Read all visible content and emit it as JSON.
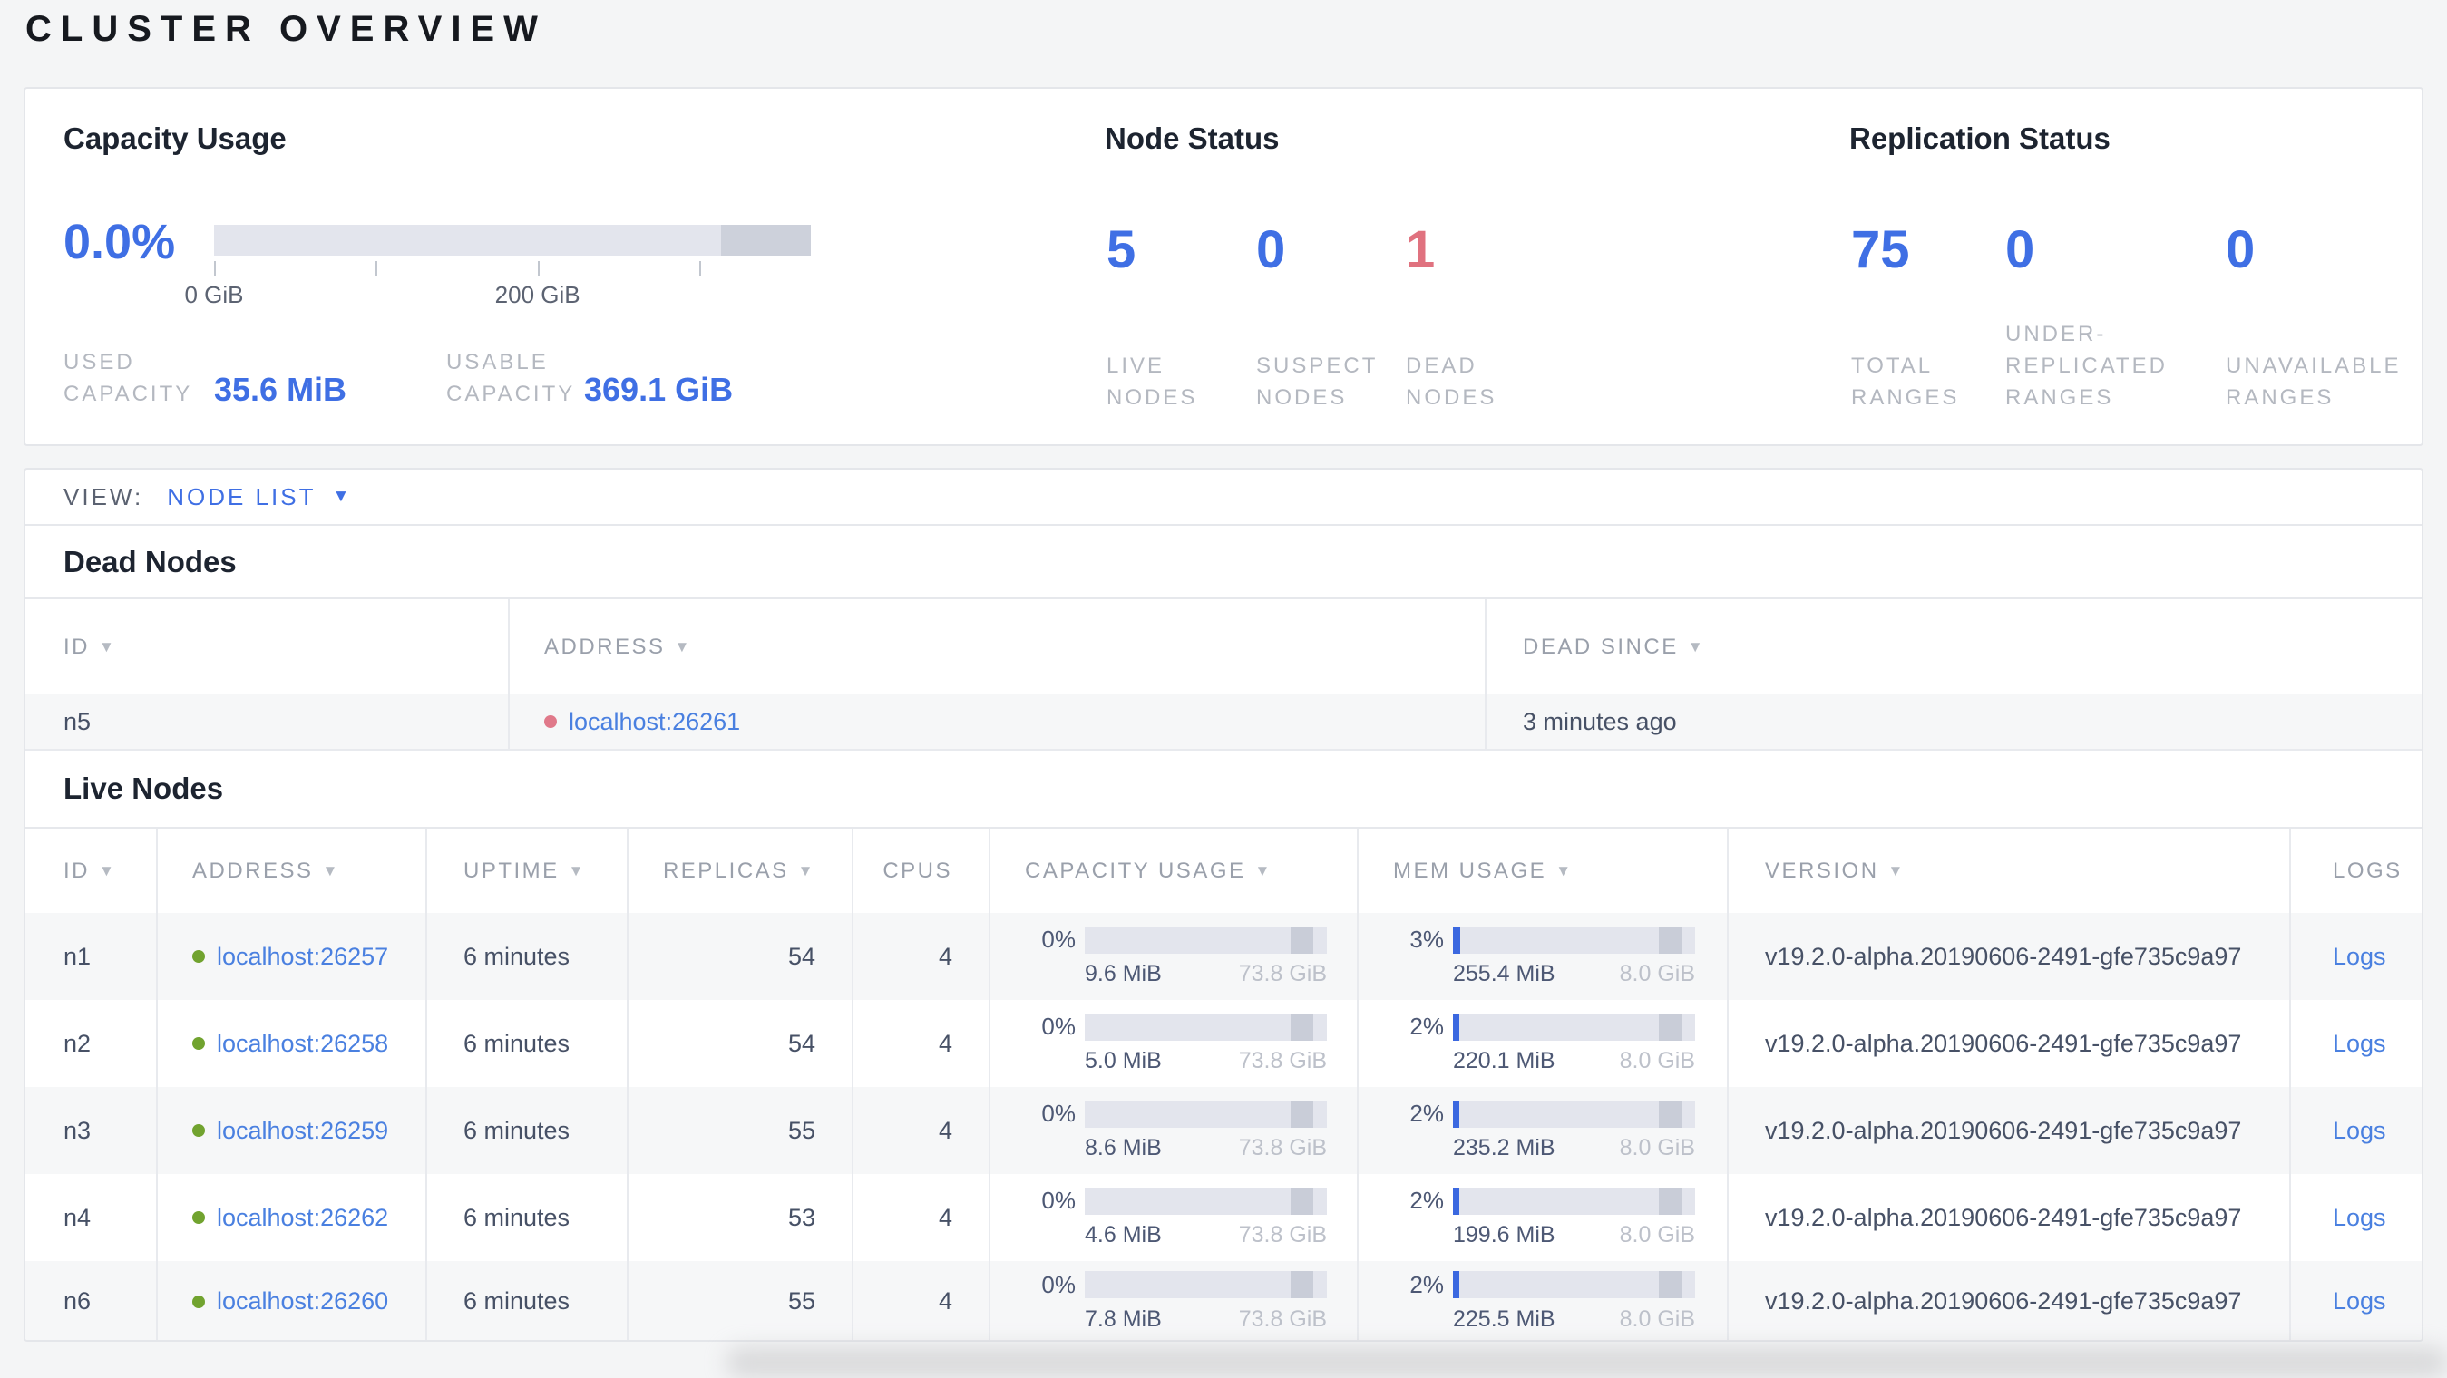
{
  "page": {
    "title": "CLUSTER OVERVIEW"
  },
  "colors": {
    "accent_blue": "#3f6fe4",
    "danger_red": "#e0727f",
    "link_blue": "#4a80e0",
    "live_green": "#71a32f",
    "dead_red": "#e0798a",
    "bar_track": "#e3e5ed",
    "bar_remainder": "#cdd1db",
    "bar_used_blue": "#3b68e0"
  },
  "summary": {
    "capacity": {
      "heading": "Capacity Usage",
      "percent": "0.0%",
      "axis": {
        "tick0_label": "0 GiB",
        "tick2_label": "200 GiB"
      },
      "stats": [
        {
          "label": "USED\nCAPACITY",
          "value": "35.6 MiB"
        },
        {
          "label": "USABLE\nCAPACITY",
          "value": "369.1 GiB"
        }
      ]
    },
    "node_status": {
      "heading": "Node Status",
      "stats": [
        {
          "value": "5",
          "label": "LIVE\nNODES"
        },
        {
          "value": "0",
          "label": "SUSPECT\nNODES"
        },
        {
          "value": "1",
          "label": "DEAD\nNODES"
        }
      ]
    },
    "replication": {
      "heading": "Replication Status",
      "stats": [
        {
          "value": "75",
          "label": "TOTAL\nRANGES"
        },
        {
          "value": "0",
          "label": "UNDER-\nREPLICATED\nRANGES"
        },
        {
          "value": "0",
          "label": "UNAVAILABLE\nRANGES"
        }
      ]
    }
  },
  "view_bar": {
    "label": "VIEW:",
    "selected": "NODE LIST"
  },
  "dead_nodes": {
    "heading": "Dead Nodes",
    "columns": [
      {
        "label": "ID"
      },
      {
        "label": "ADDRESS"
      },
      {
        "label": "DEAD SINCE"
      }
    ],
    "rows": [
      {
        "id": "n5",
        "address": "localhost:26261",
        "dead_since": "3 minutes ago"
      }
    ]
  },
  "live_nodes": {
    "heading": "Live Nodes",
    "logs_label": "Logs",
    "columns": [
      {
        "label": "ID"
      },
      {
        "label": "ADDRESS"
      },
      {
        "label": "UPTIME"
      },
      {
        "label": "REPLICAS"
      },
      {
        "label": "CPUS"
      },
      {
        "label": "CAPACITY USAGE"
      },
      {
        "label": "MEM USAGE"
      },
      {
        "label": "VERSION"
      },
      {
        "label": "LOGS"
      }
    ],
    "rows": [
      {
        "id": "n1",
        "address": "localhost:26257",
        "uptime": "6 minutes",
        "replicas": "54",
        "cpus": "4",
        "capacity": {
          "pct": "0%",
          "used": "9.6 MiB",
          "total": "73.8 GiB",
          "used_pct": 0
        },
        "memory": {
          "pct": "3%",
          "used": "255.4 MiB",
          "total": "8.0 GiB",
          "used_pct": 3
        },
        "version": "v19.2.0-alpha.20190606-2491-gfe735c9a97"
      },
      {
        "id": "n2",
        "address": "localhost:26258",
        "uptime": "6 minutes",
        "replicas": "54",
        "cpus": "4",
        "capacity": {
          "pct": "0%",
          "used": "5.0 MiB",
          "total": "73.8 GiB",
          "used_pct": 0
        },
        "memory": {
          "pct": "2%",
          "used": "220.1 MiB",
          "total": "8.0 GiB",
          "used_pct": 2.5
        },
        "version": "v19.2.0-alpha.20190606-2491-gfe735c9a97"
      },
      {
        "id": "n3",
        "address": "localhost:26259",
        "uptime": "6 minutes",
        "replicas": "55",
        "cpus": "4",
        "capacity": {
          "pct": "0%",
          "used": "8.6 MiB",
          "total": "73.8 GiB",
          "used_pct": 0
        },
        "memory": {
          "pct": "2%",
          "used": "235.2 MiB",
          "total": "8.0 GiB",
          "used_pct": 2.5
        },
        "version": "v19.2.0-alpha.20190606-2491-gfe735c9a97"
      },
      {
        "id": "n4",
        "address": "localhost:26262",
        "uptime": "6 minutes",
        "replicas": "53",
        "cpus": "4",
        "capacity": {
          "pct": "0%",
          "used": "4.6 MiB",
          "total": "73.8 GiB",
          "used_pct": 0
        },
        "memory": {
          "pct": "2%",
          "used": "199.6 MiB",
          "total": "8.0 GiB",
          "used_pct": 2.5
        },
        "version": "v19.2.0-alpha.20190606-2491-gfe735c9a97"
      },
      {
        "id": "n6",
        "address": "localhost:26260",
        "uptime": "6 minutes",
        "replicas": "55",
        "cpus": "4",
        "capacity": {
          "pct": "0%",
          "used": "7.8 MiB",
          "total": "73.8 GiB",
          "used_pct": 0
        },
        "memory": {
          "pct": "2%",
          "used": "225.5 MiB",
          "total": "8.0 GiB",
          "used_pct": 2.5
        },
        "version": "v19.2.0-alpha.20190606-2491-gfe735c9a97"
      }
    ]
  }
}
